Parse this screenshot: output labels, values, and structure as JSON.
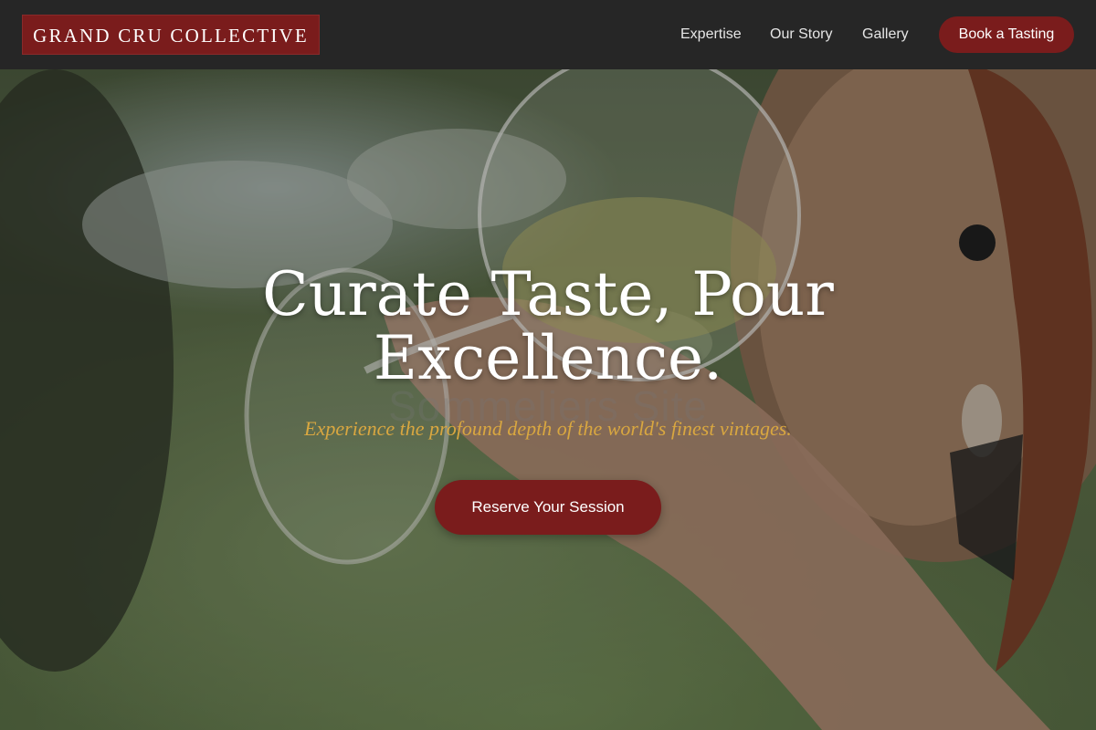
{
  "header": {
    "logo_text": "GRAND CRU COLLECTIVE",
    "nav": {
      "expertise": "Expertise",
      "our_story": "Our Story",
      "gallery": "Gallery"
    },
    "cta_label": "Book a Tasting"
  },
  "hero": {
    "title": "Curate Taste, Pour Excellence.",
    "ghost_text": "Sommeliers Site",
    "subtitle": "Experience the profound depth of the world's finest vintages.",
    "cta_label": "Reserve Your Session"
  },
  "colors": {
    "header_background": "#262626",
    "accent": "#7a1c1c",
    "subtitle_gold": "#d9a740",
    "text_light": "#ffffff"
  }
}
